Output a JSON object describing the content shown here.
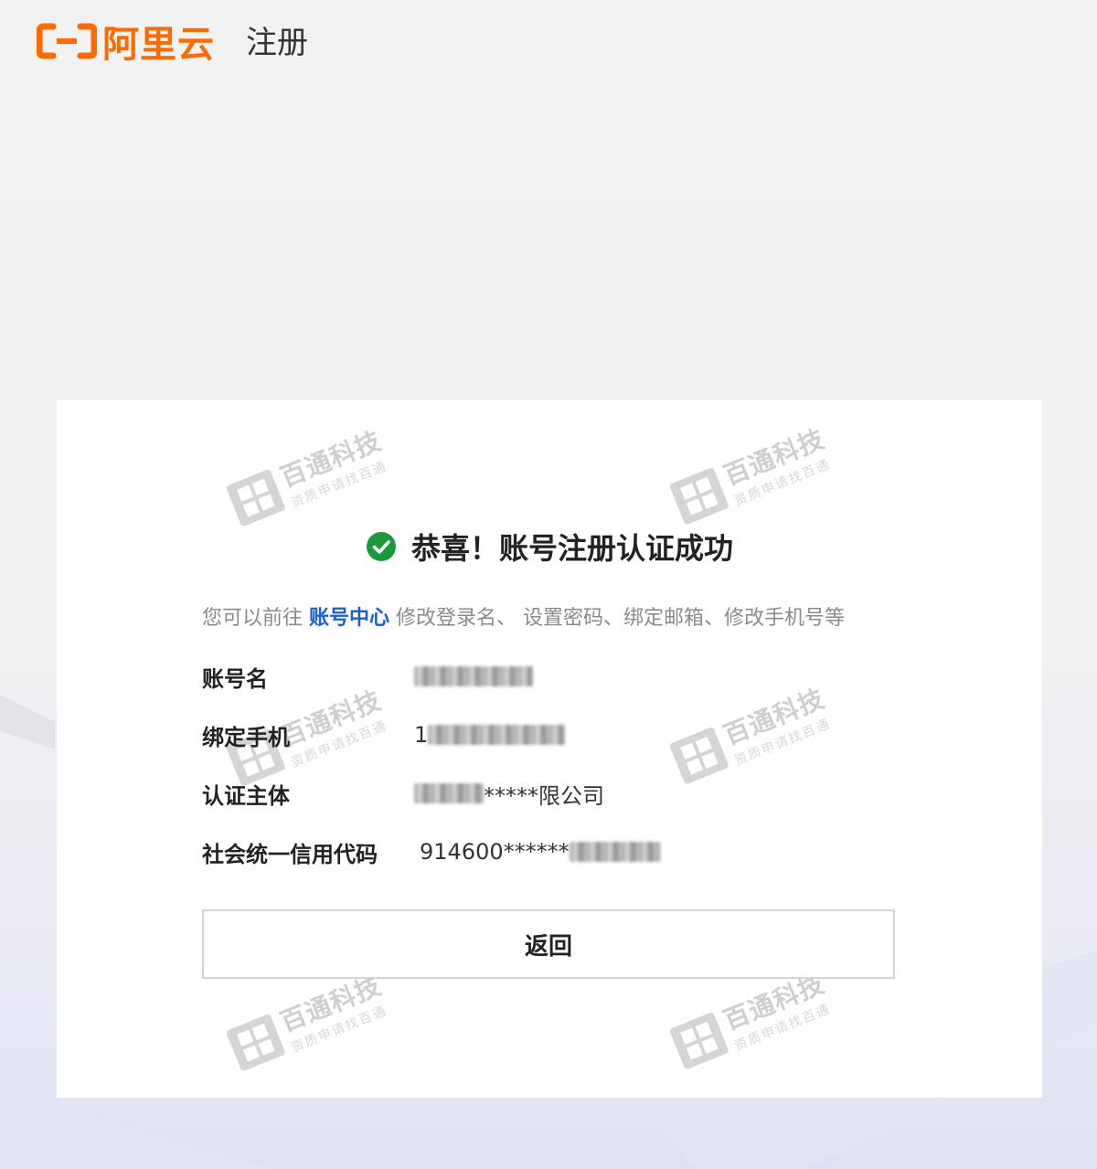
{
  "header": {
    "logo_text": "阿里云",
    "page_title": "注册"
  },
  "card": {
    "success_title": "恭喜！账号注册认证成功",
    "hint": {
      "prefix": "您可以前往 ",
      "link": "账号中心",
      "suffix": " 修改登录名、 设置密码、绑定邮箱、修改手机号等"
    },
    "fields": [
      {
        "label": "账号名",
        "value_prefix": "",
        "value_suffix": ""
      },
      {
        "label": "绑定手机",
        "value_prefix": "1",
        "value_suffix": ""
      },
      {
        "label": "认证主体",
        "value_prefix": "",
        "value_suffix": "*****限公司"
      },
      {
        "label": "社会统一信用代码",
        "value_prefix": "914600******",
        "value_suffix": ""
      }
    ],
    "back_button": "返回"
  },
  "watermark": {
    "main": "百通科技",
    "sub": "资质申请找百通"
  },
  "colors": {
    "brand_orange": "#ff6a00",
    "success_green": "#1a9a3b",
    "link_blue": "#1a5fd6"
  },
  "icons": {
    "logo": "aliyun-logo-icon",
    "success": "check-circle-icon",
    "watermark": "baitong-logo-icon"
  }
}
